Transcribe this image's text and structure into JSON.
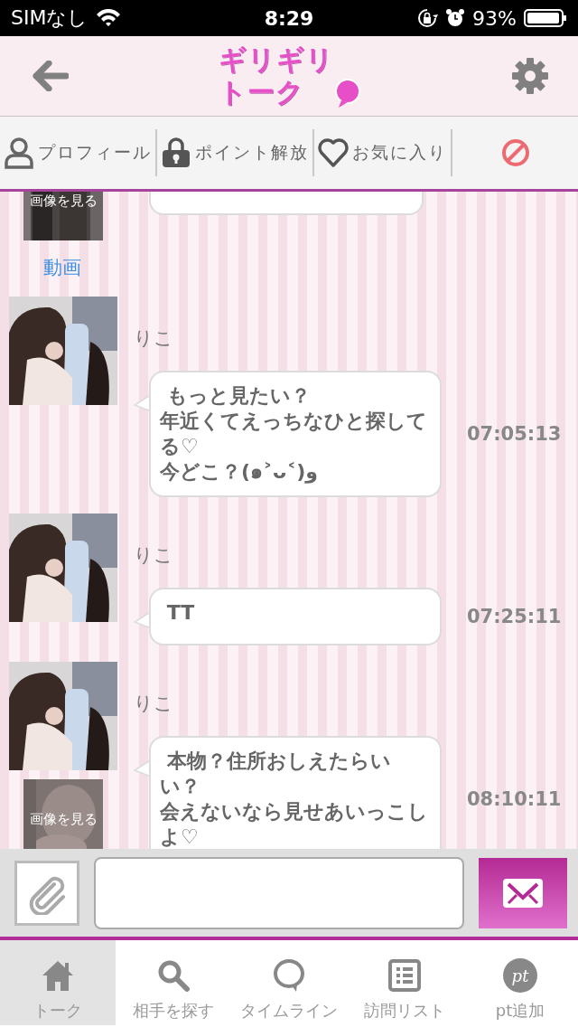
{
  "status_bar": {
    "carrier": "SIMなし",
    "time": "8:29",
    "battery": "93%"
  },
  "header": {
    "logo_lines": [
      "ギリギリ",
      "トーク"
    ]
  },
  "actions": [
    {
      "kind": "profile",
      "label": "プロフィール"
    },
    {
      "kind": "points",
      "label": "ポイント解放"
    },
    {
      "kind": "favorite",
      "label": "お気に入り"
    },
    {
      "kind": "block"
    }
  ],
  "messages": [
    {
      "kind": "partial",
      "attachment": {
        "label": "画像を見る"
      },
      "link": "動画"
    },
    {
      "kind": "message",
      "name": "りこ",
      "avatar": {
        "kind": "picture"
      },
      "lines": [
        " もっと見たい？",
        "年近くてえっちなひと探してる♡",
        "今どこ？(๑˃ᴗ˂)و"
      ],
      "time": "07:05:13"
    },
    {
      "kind": "message",
      "name": "りこ",
      "avatar": {
        "kind": "picture"
      },
      "lines": [
        " TT"
      ],
      "time": "07:25:11"
    },
    {
      "kind": "message",
      "name": "りこ",
      "avatar": {
        "kind": "picture"
      },
      "lines": [
        " 本物？住所おしえたらいい？",
        "会えないなら見せあいっこしよ♡"
      ],
      "time": "08:10:11",
      "attachment": {
        "label": "画像を見る"
      }
    }
  ],
  "tabs": [
    {
      "kind": "talk",
      "label": "トーク",
      "selected": true
    },
    {
      "kind": "search",
      "label": "相手を探す",
      "selected": false
    },
    {
      "kind": "timeline",
      "label": "タイムライン",
      "selected": false
    },
    {
      "kind": "visits",
      "label": "訪問リスト",
      "selected": false
    },
    {
      "kind": "points",
      "label": "pt追加",
      "icon_text": "pt",
      "selected": false
    }
  ]
}
